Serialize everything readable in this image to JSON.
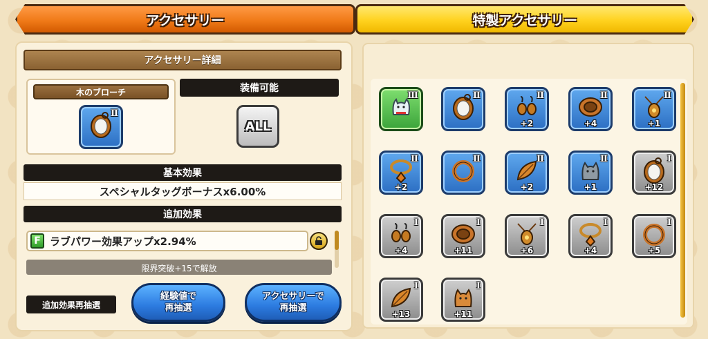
{
  "tabs": {
    "accessory": "アクセサリー",
    "special_accessory": "特製アクセサリー"
  },
  "detail": {
    "header": "アクセサリー詳細",
    "item_name": "木のブローチ",
    "item_rank": "Ⅱ",
    "item_icon": "brooch-icon",
    "equip_header": "装備可能",
    "equip_value": "ALL",
    "base_effect_header": "基本効果",
    "base_effect_text": "スペシャルタッグボーナスx6.00%",
    "extra_effect_header": "追加効果",
    "extra_effect_grade": "F",
    "extra_effect_text": "ラブパワー効果アップx2.94%",
    "locked_text": "限界突破+15で解放",
    "reroll_label": "追加効果再抽選",
    "reroll_exp_line1": "経験値で",
    "reroll_exp_line2": "再抽選",
    "reroll_acc_line1": "アクセサリーで",
    "reroll_acc_line2": "再抽選"
  },
  "grid": [
    {
      "icon": "cat-figure-icon",
      "rank": "Ⅲ",
      "plus": "",
      "frame": "green"
    },
    {
      "icon": "brooch-icon",
      "rank": "Ⅱ",
      "plus": "",
      "frame": "blue"
    },
    {
      "icon": "earrings-icon",
      "rank": "Ⅱ",
      "plus": "+2",
      "frame": "blue"
    },
    {
      "icon": "bracelet-icon",
      "rank": "Ⅱ",
      "plus": "+4",
      "frame": "blue"
    },
    {
      "icon": "pendant-icon",
      "rank": "Ⅱ",
      "plus": "+1",
      "frame": "blue"
    },
    {
      "icon": "necklace-icon",
      "rank": "Ⅱ",
      "plus": "+2",
      "frame": "blue"
    },
    {
      "icon": "ring-icon",
      "rank": "Ⅱ",
      "plus": "",
      "frame": "blue"
    },
    {
      "icon": "leaf-icon",
      "rank": "Ⅱ",
      "plus": "+2",
      "frame": "blue"
    },
    {
      "icon": "wolf-figure-icon",
      "rank": "Ⅱ",
      "plus": "+1",
      "frame": "blue"
    },
    {
      "icon": "brooch-icon",
      "rank": "Ⅰ",
      "plus": "+12",
      "frame": "grey"
    },
    {
      "icon": "earrings-icon",
      "rank": "Ⅰ",
      "plus": "+4",
      "frame": "grey"
    },
    {
      "icon": "bracelet-icon",
      "rank": "Ⅰ",
      "plus": "+11",
      "frame": "grey"
    },
    {
      "icon": "pendant-icon",
      "rank": "Ⅰ",
      "plus": "+6",
      "frame": "grey"
    },
    {
      "icon": "necklace-icon",
      "rank": "Ⅰ",
      "plus": "+4",
      "frame": "grey"
    },
    {
      "icon": "ring-icon",
      "rank": "Ⅰ",
      "plus": "+5",
      "frame": "grey"
    },
    {
      "icon": "leaf-icon",
      "rank": "Ⅰ",
      "plus": "+13",
      "frame": "grey"
    },
    {
      "icon": "fox-figure-icon",
      "rank": "Ⅰ",
      "plus": "+11",
      "frame": "grey"
    }
  ]
}
